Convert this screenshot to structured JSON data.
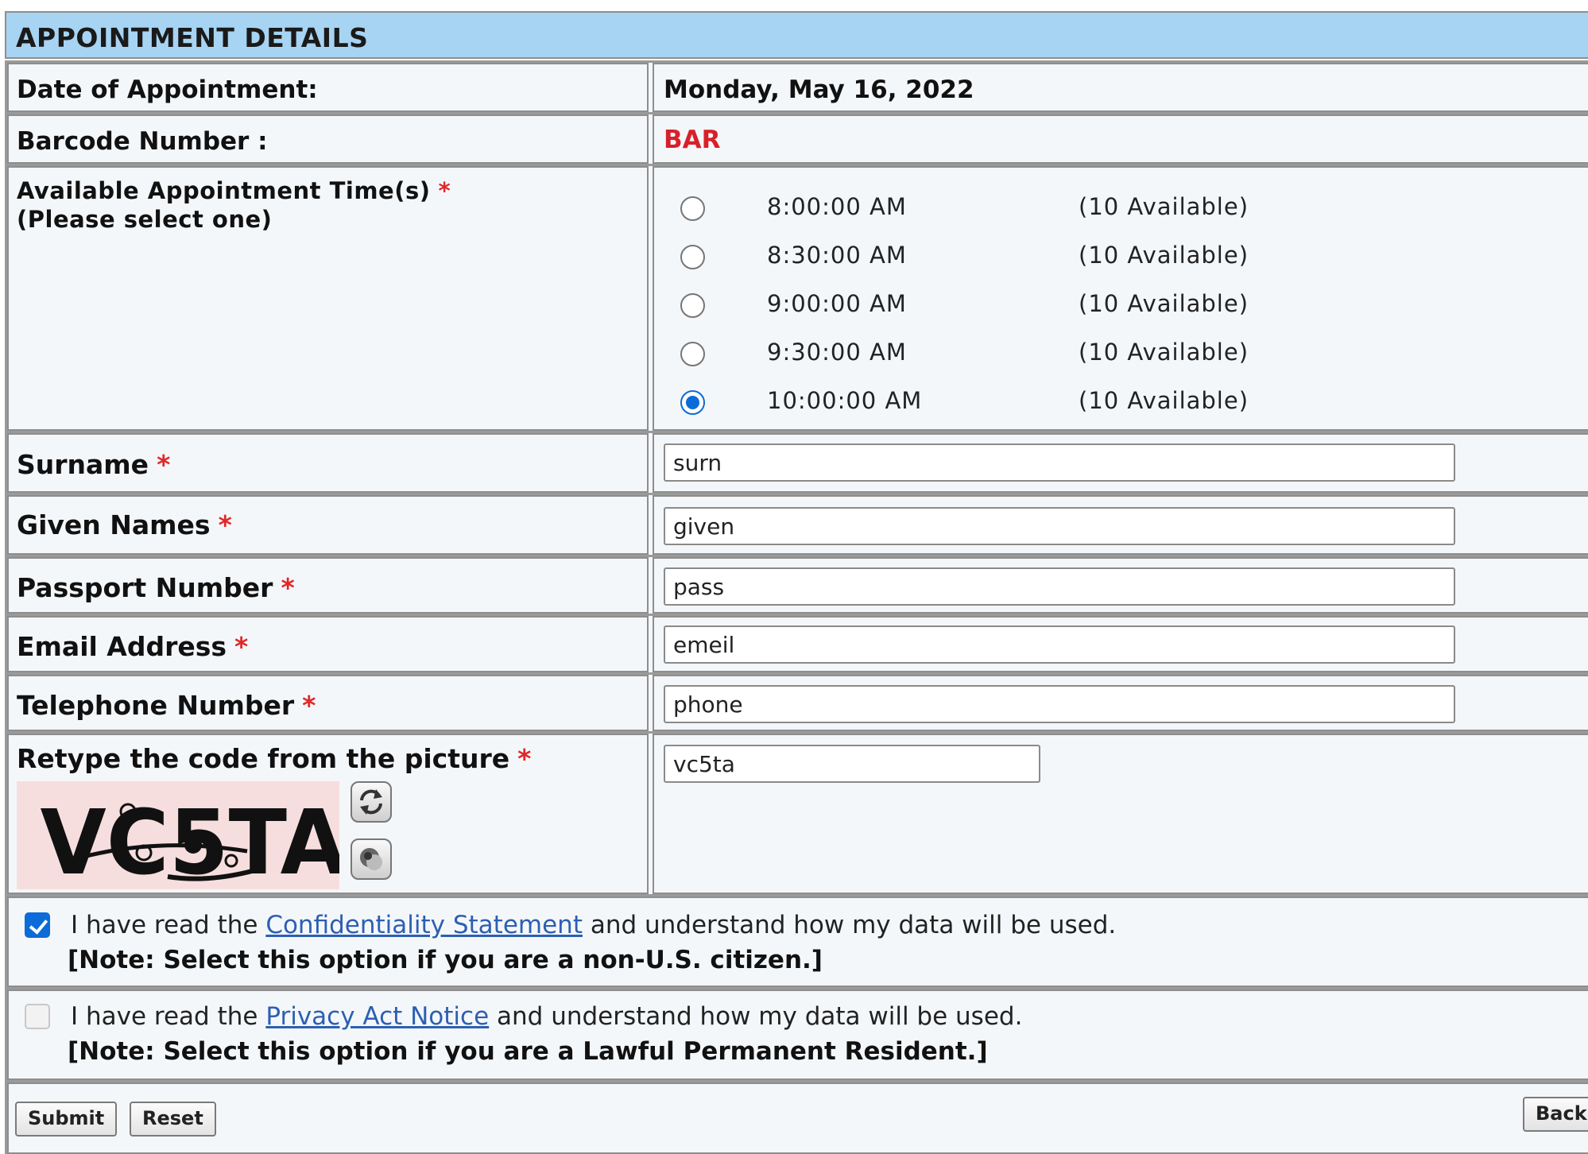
{
  "section_title": "APPOINTMENT DETAILS",
  "date_row": {
    "label": "Date of Appointment:",
    "value": "Monday, May 16, 2022"
  },
  "barcode_row": {
    "label": "Barcode Number :",
    "value": "BAR"
  },
  "times": {
    "label_line1": "Available Appointment Time(s)",
    "label_line2": "(Please select one)",
    "required_mark": "*",
    "slots": [
      {
        "time": "8:00:00 AM",
        "availability": "(10 Available)",
        "selected": false
      },
      {
        "time": "8:30:00 AM",
        "availability": "(10 Available)",
        "selected": false
      },
      {
        "time": "9:00:00 AM",
        "availability": "(10 Available)",
        "selected": false
      },
      {
        "time": "9:30:00 AM",
        "availability": "(10 Available)",
        "selected": false
      },
      {
        "time": "10:00:00 AM",
        "availability": "(10 Available)",
        "selected": true
      }
    ]
  },
  "fields": {
    "surname": {
      "label": "Surname",
      "value": "surn"
    },
    "given_names": {
      "label": "Given Names",
      "value": "given"
    },
    "passport": {
      "label": "Passport Number",
      "value": "pass"
    },
    "email": {
      "label": "Email Address",
      "value": "emeil"
    },
    "telephone": {
      "label": "Telephone Number",
      "value": "phone"
    },
    "captcha": {
      "label": "Retype the code from the picture",
      "value": "vc5ta",
      "image_text": "VC5TA"
    }
  },
  "required_mark": "*",
  "ack_confidentiality": {
    "checked": true,
    "text_before": "I have read the ",
    "link": "Confidentiality Statement",
    "text_after": " and understand how my data will be used.",
    "note": "[Note: Select this option if you are a non-U.S. citizen.]"
  },
  "ack_privacy": {
    "checked": false,
    "text_before": "I have read the ",
    "link": "Privacy Act Notice",
    "text_after": " and understand how my data will be used.",
    "note": "[Note: Select this option if you are a Lawful Permanent Resident.]"
  },
  "buttons": {
    "submit": "Submit",
    "reset": "Reset",
    "back": "Back"
  },
  "icons": {
    "refresh": "refresh-captcha-icon",
    "audio": "audio-captcha-icon"
  },
  "colors": {
    "header_bg": "#a7d4f2",
    "required": "#e02828",
    "barcode": "#d8202a",
    "link": "#2d5fb2",
    "accent": "#0b6bd8"
  }
}
